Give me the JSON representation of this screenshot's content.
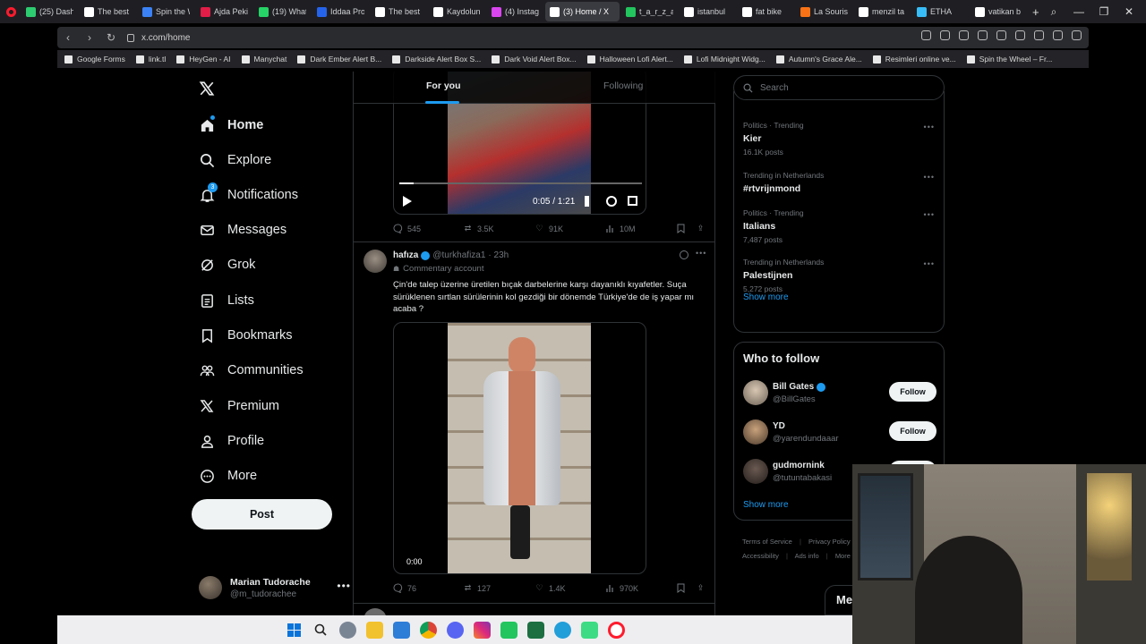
{
  "browser": {
    "tabs": [
      {
        "label": "(25) Dash",
        "color": "#2ecc71"
      },
      {
        "label": "The best",
        "color": "#ffffff"
      },
      {
        "label": "Spin the W",
        "color": "#3b82f6"
      },
      {
        "label": "Ajda Peki",
        "color": "#e11d48"
      },
      {
        "label": "(19) What",
        "color": "#25d366"
      },
      {
        "label": "Iddaa Pro",
        "color": "#2563eb"
      },
      {
        "label": "The best",
        "color": "#ffffff"
      },
      {
        "label": "Kaydolun",
        "color": "#ffffff"
      },
      {
        "label": "(4) Instag",
        "color": "#d946ef"
      },
      {
        "label": "(3) Home / X",
        "color": "#ffffff",
        "active": true
      },
      {
        "label": "t_a_r_z_a",
        "color": "#22c55e"
      },
      {
        "label": "istanbul",
        "color": "#ffffff"
      },
      {
        "label": "fat bike",
        "color": "#ffffff"
      },
      {
        "label": "La Souris",
        "color": "#f97316"
      },
      {
        "label": "menzil ta",
        "color": "#ffffff"
      },
      {
        "label": "ETHA",
        "color": "#38bdf8"
      },
      {
        "label": "vatikan b",
        "color": "#ffffff"
      }
    ],
    "new_tab": "+",
    "url": "x.com/home",
    "bookmarks": [
      "Google Forms",
      "link.tl",
      "HeyGen - AI",
      "Manychat",
      "Dark Ember Alert B...",
      "Darkside Alert Box S...",
      "Dark Void Alert Box...",
      "Halloween Lofi Alert...",
      "Lofi Midnight Widg...",
      "Autumn's Grace Ale...",
      "Resimleri online ve...",
      "Spin the Wheel – Fr..."
    ]
  },
  "nav": {
    "items": [
      {
        "label": "Home",
        "icon": "home-icon"
      },
      {
        "label": "Explore",
        "icon": "search-icon"
      },
      {
        "label": "Notifications",
        "icon": "bell-icon",
        "badge": "3"
      },
      {
        "label": "Messages",
        "icon": "mail-icon"
      },
      {
        "label": "Grok",
        "icon": "grok-icon"
      },
      {
        "label": "Lists",
        "icon": "list-icon"
      },
      {
        "label": "Bookmarks",
        "icon": "bookmark-icon"
      },
      {
        "label": "Communities",
        "icon": "people-icon"
      },
      {
        "label": "Premium",
        "icon": "x-icon"
      },
      {
        "label": "Profile",
        "icon": "person-icon"
      },
      {
        "label": "More",
        "icon": "more-circle-icon"
      }
    ],
    "post_label": "Post",
    "account": {
      "name": "Marian Tudorache",
      "handle": "@m_tudorachee"
    }
  },
  "feed": {
    "tabs": [
      "For you",
      "Following"
    ],
    "video1": {
      "time": "0:05 / 1:21",
      "progress": 0.06
    },
    "tweet1_stats": {
      "replies": "545",
      "reposts": "3.5K",
      "likes": "91K",
      "views": "10M"
    },
    "tweet2": {
      "name": "hafıza",
      "handle": "@turkhafiza1",
      "time": "· 23h",
      "label": "Commentary account",
      "text": "Çin'de talep üzerine üretilen bıçak darbelerine karşı dayanıklı kıyafetler. Suça sürüklenen sırtlan sürülerinin kol gezdiği bir dönemde Türkiye'de de iş yapar mı acaba ?",
      "video_time": "0:00",
      "stats": {
        "replies": "76",
        "reposts": "127",
        "likes": "1.4K",
        "views": "970K"
      }
    }
  },
  "sidebar": {
    "search_placeholder": "Search",
    "trends": [
      {
        "category": "Politics · Trending",
        "name": "Kier",
        "posts": "16.1K posts"
      },
      {
        "category": "Trending in Netherlands",
        "name": "#rtvrijnmond",
        "posts": ""
      },
      {
        "category": "Politics · Trending",
        "name": "Italians",
        "posts": "7,487 posts"
      },
      {
        "category": "Trending in Netherlands",
        "name": "Palestijnen",
        "posts": "5,272 posts"
      }
    ],
    "show_more": "Show more",
    "who_to_follow_title": "Who to follow",
    "follow": [
      {
        "name": "Bill Gates",
        "handle": "@BillGates",
        "verified": true,
        "button": "Follow"
      },
      {
        "name": "YD",
        "handle": "@yarendundaaar",
        "verified": false,
        "button": "Follow"
      },
      {
        "name": "gudmornink",
        "handle": "@tutuntabakasi",
        "verified": false,
        "button": "Follow"
      }
    ],
    "footer": [
      "Terms of Service",
      "Privacy Policy",
      "Accessibility",
      "Ads info",
      "More"
    ],
    "messages_peek": "Me"
  },
  "colors": {
    "accent": "#1d9bf0",
    "background": "#000000",
    "muted": "#71767b",
    "border": "#2f3336"
  }
}
